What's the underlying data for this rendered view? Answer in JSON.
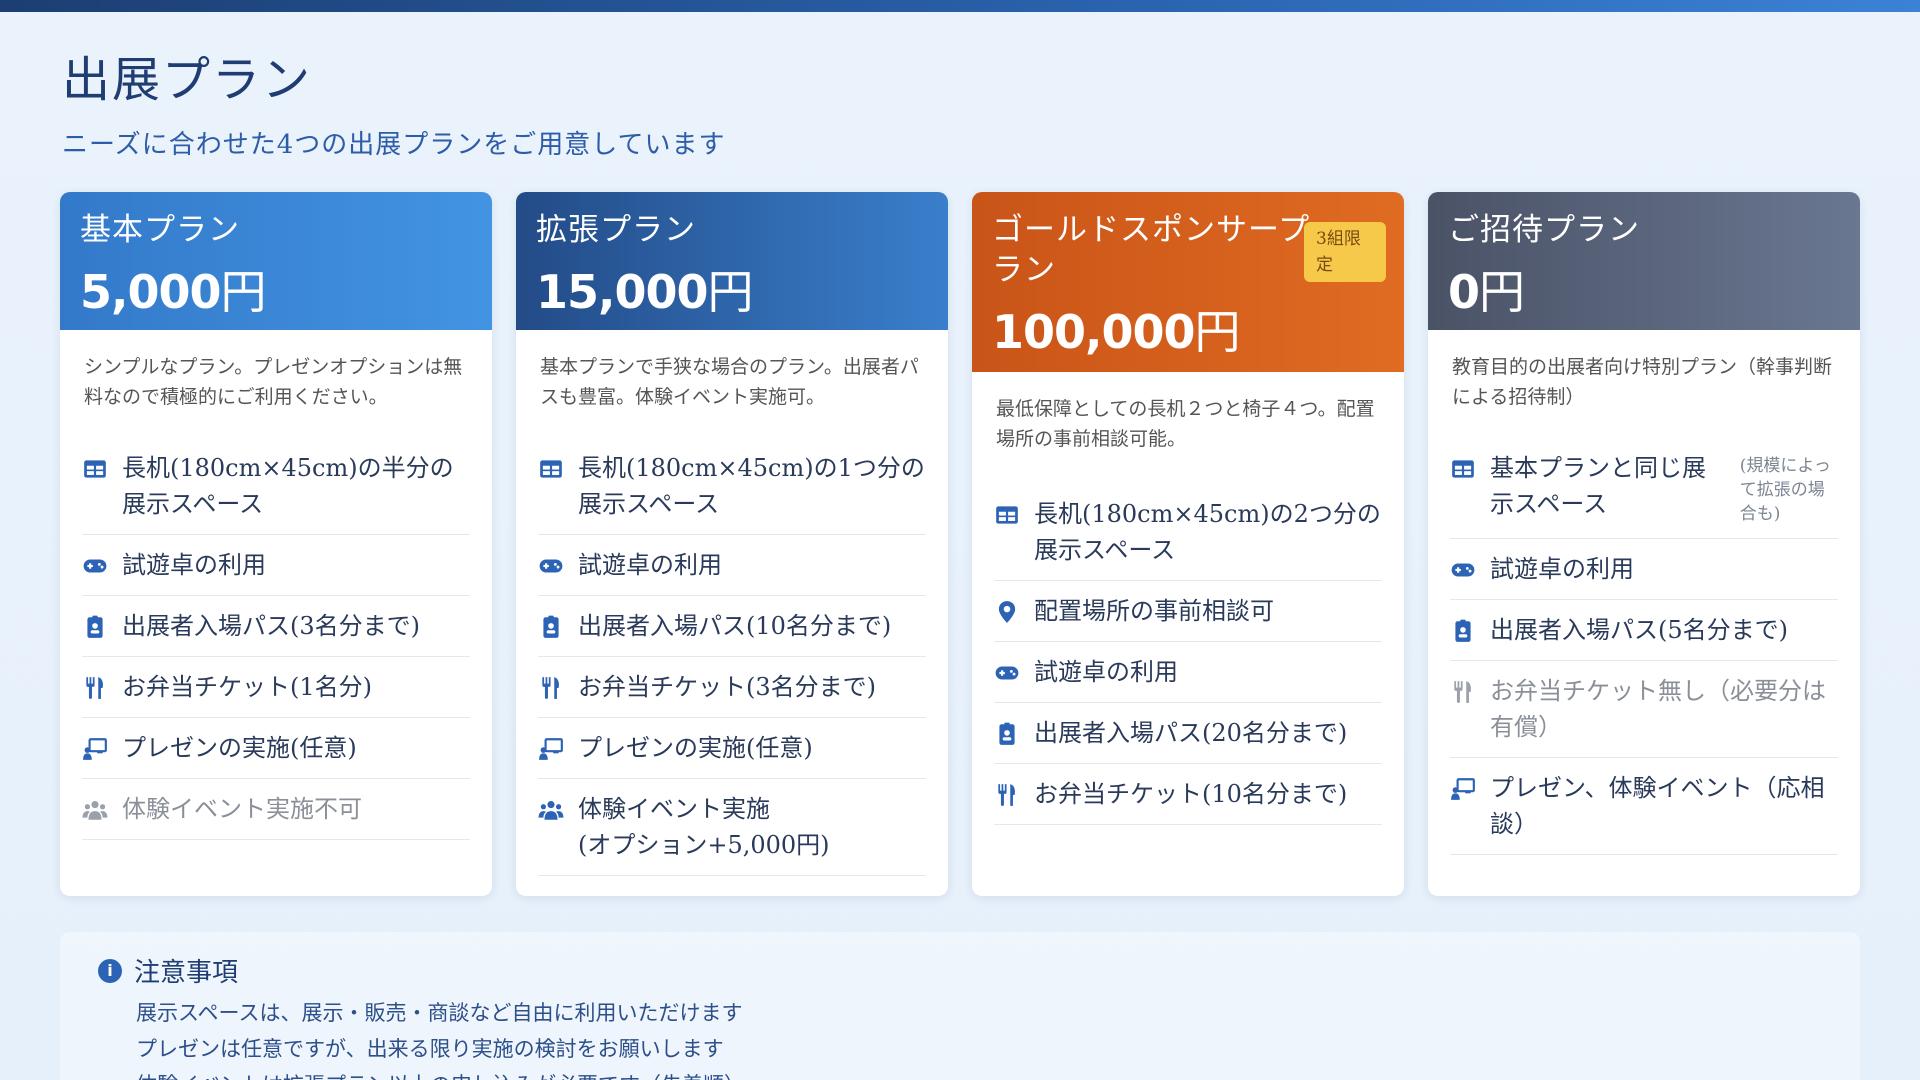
{
  "header": {
    "title": "出展プラン",
    "subtitle": "ニーズに合わせた4つの出展プランをご用意しています"
  },
  "plans": [
    {
      "name": "基本プラン",
      "price": "5,000",
      "unit": "円",
      "description": "シンプルなプラン。プレゼンオプションは無料なので積極的にご利用ください。",
      "features": [
        {
          "icon": "table-icon",
          "text": "長机(180cm×45cm)の半分の展示スペース",
          "muted": false
        },
        {
          "icon": "gamepad-icon",
          "text": "試遊卓の利用",
          "muted": false
        },
        {
          "icon": "badge-icon",
          "text": "出展者入場パス(3名分まで)",
          "muted": false
        },
        {
          "icon": "utensils-icon",
          "text": "お弁当チケット(1名分)",
          "muted": false
        },
        {
          "icon": "presentation-icon",
          "text": "プレゼンの実施(任意)",
          "muted": false
        },
        {
          "icon": "users-icon",
          "text": "体験イベント実施不可",
          "muted": true
        }
      ]
    },
    {
      "name": "拡張プラン",
      "price": "15,000",
      "unit": "円",
      "description": "基本プランで手狭な場合のプラン。出展者パスも豊富。体験イベント実施可。",
      "features": [
        {
          "icon": "table-icon",
          "text": "長机(180cm×45cm)の1つ分の展示スペース",
          "muted": false
        },
        {
          "icon": "gamepad-icon",
          "text": "試遊卓の利用",
          "muted": false
        },
        {
          "icon": "badge-icon",
          "text": "出展者入場パス(10名分まで)",
          "muted": false
        },
        {
          "icon": "utensils-icon",
          "text": "お弁当チケット(3名分まで)",
          "muted": false
        },
        {
          "icon": "presentation-icon",
          "text": "プレゼンの実施(任意)",
          "muted": false
        },
        {
          "icon": "users-icon",
          "text": "体験イベント実施\n(オプション+5,000円)",
          "muted": false
        }
      ]
    },
    {
      "name": "ゴールドスポンサープラン",
      "price": "100,000",
      "unit": "円",
      "badge": "3組限定",
      "description": "最低保障としての長机２つと椅子４つ。配置場所の事前相談可能。",
      "features": [
        {
          "icon": "table-icon",
          "text": "長机(180cm×45cm)の2つ分の展示スペース",
          "muted": false
        },
        {
          "icon": "map-pin-icon",
          "text": "配置場所の事前相談可",
          "muted": false
        },
        {
          "icon": "gamepad-icon",
          "text": "試遊卓の利用",
          "muted": false
        },
        {
          "icon": "badge-icon",
          "text": "出展者入場パス(20名分まで)",
          "muted": false
        },
        {
          "icon": "utensils-icon",
          "text": "お弁当チケット(10名分まで)",
          "muted": false
        }
      ]
    },
    {
      "name": "ご招待プラン",
      "price": "0",
      "unit": "円",
      "description": "教育目的の出展者向け特別プラン（幹事判断による招待制）",
      "features": [
        {
          "icon": "table-icon",
          "text": "基本プランと同じ展示スペース",
          "note": "(規模によって拡張の場合も)",
          "muted": false
        },
        {
          "icon": "gamepad-icon",
          "text": "試遊卓の利用",
          "muted": false
        },
        {
          "icon": "badge-icon",
          "text": "出展者入場パス(5名分まで)",
          "muted": false
        },
        {
          "icon": "utensils-icon",
          "text": "お弁当チケット無し（必要分は有償）",
          "muted": true
        },
        {
          "icon": "presentation-icon",
          "text": "プレゼン、体験イベント（応相談）",
          "muted": false
        }
      ]
    }
  ],
  "notice": {
    "title": "注意事項",
    "items": [
      "展示スペースは、展示・販売・商談など自由に利用いただけます",
      "プレゼンは任意ですが、出来る限り実施の検討をお願いします",
      "体験イベントは拡張プラン以上の申し込みが必要です（先着順）"
    ]
  },
  "colors": {
    "basic": "#3f8fdf",
    "extended": "#2a5a9e",
    "gold": "#d85f1e",
    "invite": "#5a647a",
    "badge": "#f7c94a",
    "accent": "#2d63b5"
  }
}
